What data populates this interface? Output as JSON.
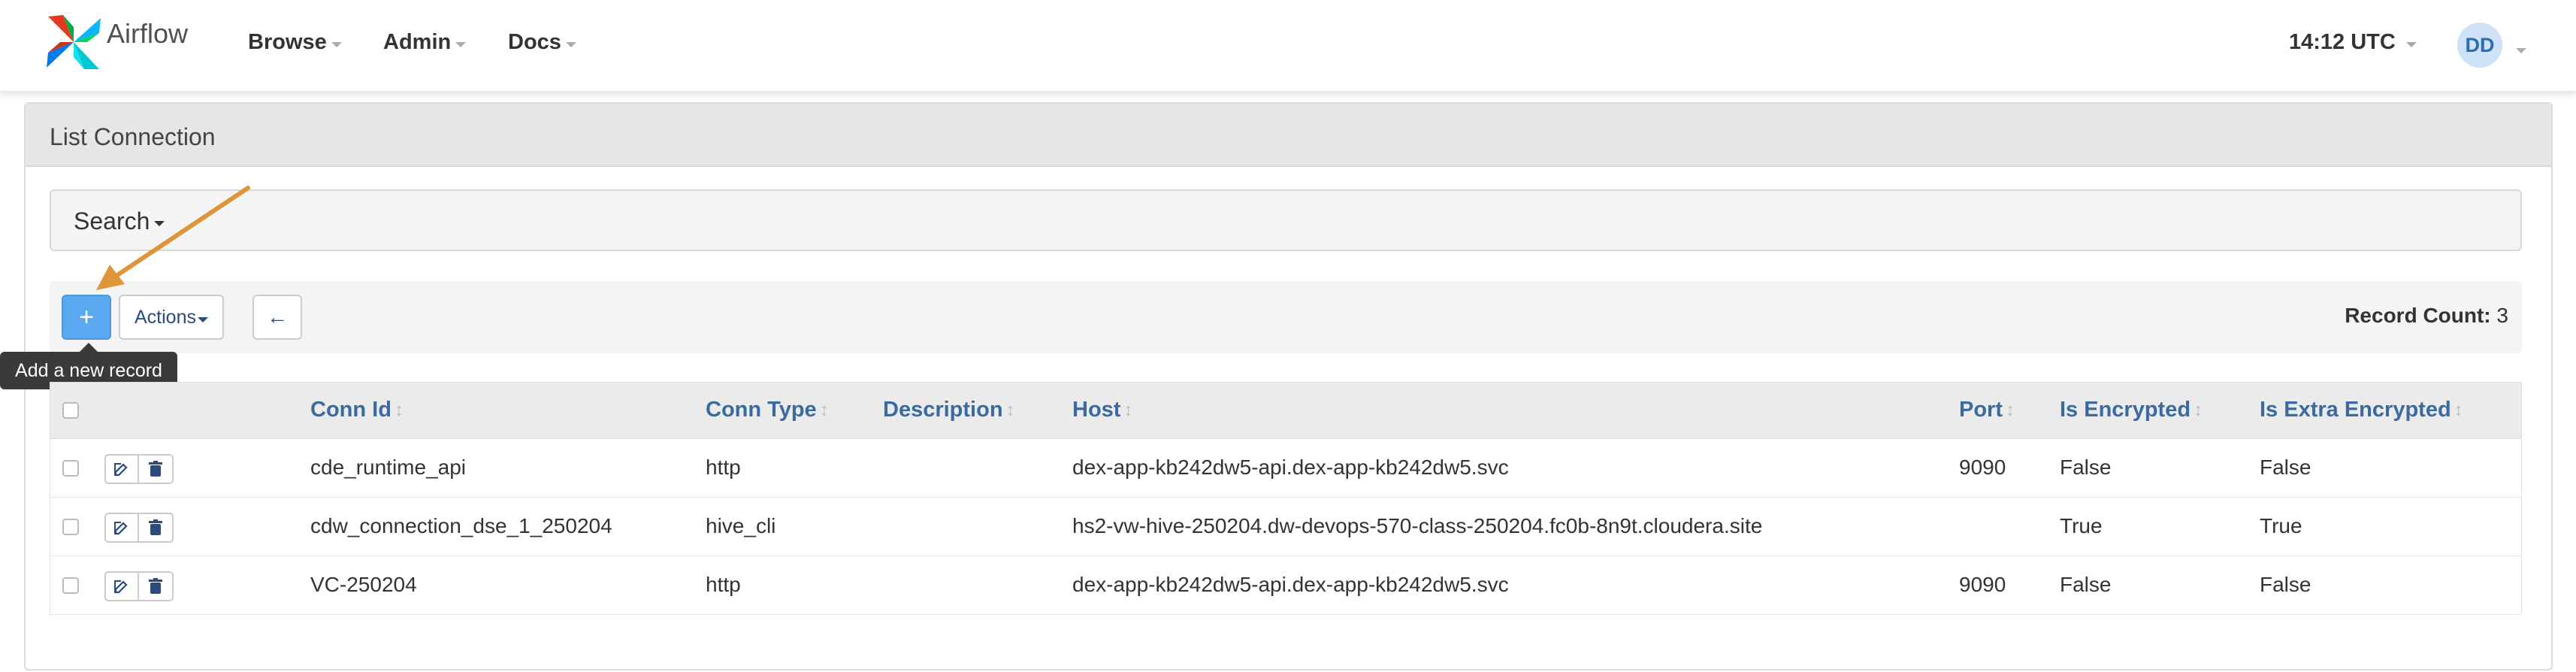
{
  "navbar": {
    "brand": "Airflow",
    "menu": [
      {
        "label": "Browse"
      },
      {
        "label": "Admin"
      },
      {
        "label": "Docs"
      }
    ],
    "clock": "14:12 UTC",
    "avatar_initials": "DD"
  },
  "panel": {
    "title": "List Connection",
    "search_label": "Search"
  },
  "toolbar": {
    "add_label": "+",
    "actions_label": "Actions",
    "back_label": "←",
    "record_count_label": "Record Count:",
    "record_count_value": "3",
    "add_tooltip": "Add a new record"
  },
  "table": {
    "columns": [
      "Conn Id",
      "Conn Type",
      "Description",
      "Host",
      "Port",
      "Is Encrypted",
      "Is Extra Encrypted"
    ],
    "rows": [
      {
        "conn_id": "cde_runtime_api",
        "conn_type": "http",
        "description": "",
        "host": "dex-app-kb242dw5-api.dex-app-kb242dw5.svc",
        "port": "9090",
        "is_encrypted": "False",
        "is_extra_encrypted": "False"
      },
      {
        "conn_id": "cdw_connection_dse_1_250204",
        "conn_type": "hive_cli",
        "description": "",
        "host": "hs2-vw-hive-250204.dw-devops-570-class-250204.fc0b-8n9t.cloudera.site",
        "port": "",
        "is_encrypted": "True",
        "is_extra_encrypted": "True"
      },
      {
        "conn_id": "VC-250204",
        "conn_type": "http",
        "description": "",
        "host": "dex-app-kb242dw5-api.dex-app-kb242dw5.svc",
        "port": "9090",
        "is_encrypted": "False",
        "is_extra_encrypted": "False"
      }
    ]
  },
  "colors": {
    "primary_button": "#5aa9f0",
    "column_header": "#3b6aa0",
    "annotation_arrow": "#e0953a"
  }
}
